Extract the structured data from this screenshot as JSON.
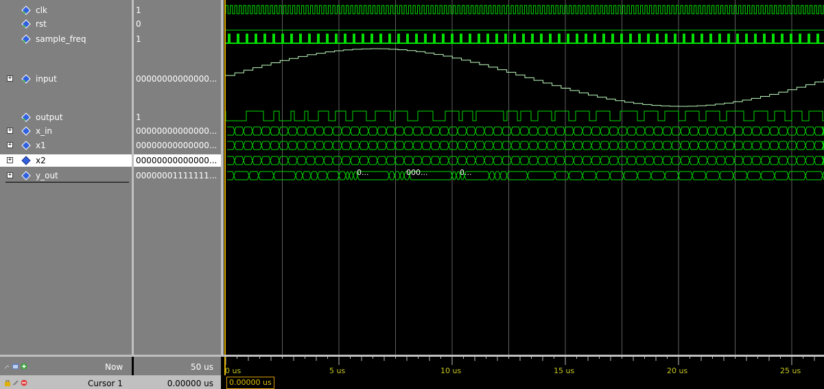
{
  "signals": [
    {
      "name": "clk",
      "value": "1",
      "expandable": false,
      "selected": false
    },
    {
      "name": "rst",
      "value": "0",
      "expandable": false,
      "selected": false
    },
    {
      "name": "sample_freq",
      "value": "1",
      "expandable": false,
      "selected": false
    },
    {
      "name": "input",
      "value": "00000000000000...",
      "expandable": true,
      "selected": false
    },
    {
      "name": "output",
      "value": "1",
      "expandable": false,
      "selected": false
    },
    {
      "name": "x_in",
      "value": "00000000000000...",
      "expandable": true,
      "selected": false
    },
    {
      "name": "x1",
      "value": "00000000000000...",
      "expandable": true,
      "selected": false
    },
    {
      "name": "x2",
      "value": "00000000000000...",
      "expandable": true,
      "selected": true
    },
    {
      "name": "y_out",
      "value": "00000001111111...",
      "expandable": true,
      "selected": false
    }
  ],
  "bus_labels": {
    "y_out_1": "0...",
    "y_out_2": "000...",
    "y_out_3": "0..."
  },
  "footer": {
    "now_label": "Now",
    "now_value": "50 us",
    "cursor_label": "Cursor 1",
    "cursor_value": "0.00000 us",
    "cursor_readout": "0.00000 us"
  },
  "ruler": {
    "labels": [
      "0 us",
      "5 us",
      "10 us",
      "15 us",
      "20 us",
      "25 us"
    ]
  },
  "colors": {
    "wave": "#00e000",
    "analog": "#c0ffc0",
    "grid": "#606060",
    "cursor": "#e0b000",
    "ruler_text": "#c8c820"
  },
  "icons": {
    "signal": "diamond-icon",
    "expand": "plus-icon"
  }
}
